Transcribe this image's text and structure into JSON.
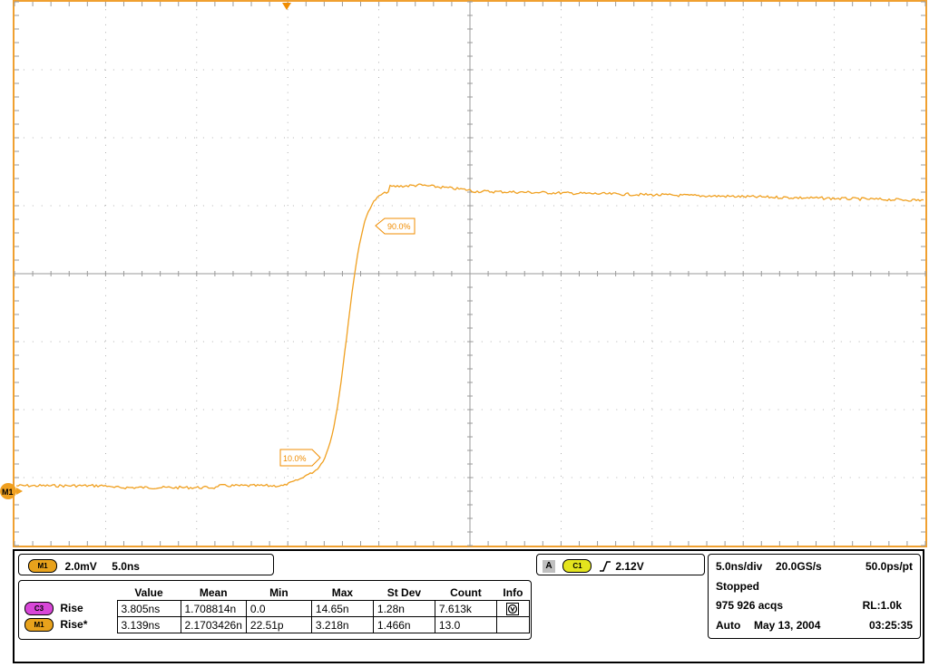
{
  "scope": {
    "colors": {
      "trace": "#f0a020",
      "frame": "#f0a030",
      "grid": "#9a9a9a",
      "label_text": "#f08c00"
    },
    "ref_marker": {
      "label": "M1"
    },
    "annotations": [
      {
        "label": "90.0%"
      },
      {
        "label": "10.0%"
      }
    ]
  },
  "vertical_settings": {
    "badge": "M1",
    "scale": "2.0mV",
    "timebase": "5.0ns"
  },
  "trigger": {
    "source_letter": "A",
    "badge": "C1",
    "slope_icon": "rising-edge-icon",
    "level": "2.12V"
  },
  "measurements": {
    "headers": [
      "Value",
      "Mean",
      "Min",
      "Max",
      "St Dev",
      "Count",
      "Info"
    ],
    "rows": [
      {
        "badge": "C3",
        "name": "Rise",
        "value": "3.805ns",
        "mean": "1.708814n",
        "min": "0.0",
        "max": "14.65n",
        "stdev": "1.28n",
        "count": "7.613k",
        "info_icon": "info-icon"
      },
      {
        "badge": "M1",
        "name": "Rise*",
        "value": "3.139ns",
        "mean": "2.1703426n",
        "min": "22.51p",
        "max": "3.218n",
        "stdev": "1.466n",
        "count": "13.0",
        "info_icon": ""
      }
    ]
  },
  "acquisition": {
    "horizontal": "5.0ns/div",
    "sample_rate": "20.0GS/s",
    "resolution": "50.0ps/pt",
    "state": "Stopped",
    "acqs": "975 926 acqs",
    "record_length": "RL:1.0k",
    "mode": "Auto",
    "date": "May 13, 2004",
    "time": "03:25:35"
  }
}
